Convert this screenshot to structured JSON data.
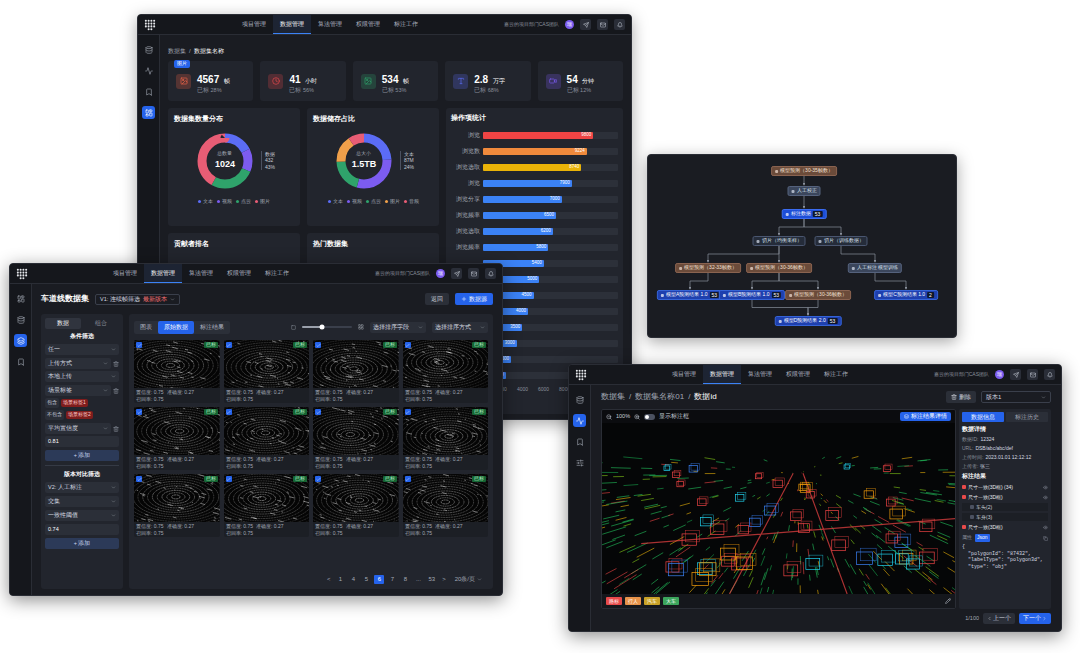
{
  "nav": {
    "items": [
      {
        "label": "项目管理",
        "selected": false
      },
      {
        "label": "数据管理",
        "selected": true
      },
      {
        "label": "算法管理",
        "selected": false
      },
      {
        "label": "权限管理",
        "selected": false
      },
      {
        "label": "标注工作",
        "selected": false
      }
    ],
    "org": "嘉云的项目部门CAS团队",
    "avatar": "瑞"
  },
  "dashboard": {
    "sidebar": [
      {
        "selected": false
      },
      {
        "selected": false
      },
      {
        "selected": false
      },
      {
        "selected": true
      }
    ],
    "breadcrumb": [
      "数据集",
      "数据集名称"
    ],
    "separator": "/",
    "stats": [
      {
        "value": "4567",
        "unit": "帧",
        "sub": "已标 28%",
        "color": "#f06548",
        "badge": "图片"
      },
      {
        "value": "41",
        "unit": "小时",
        "sub": "已标 56%",
        "color": "#e5484d"
      },
      {
        "value": "534",
        "unit": "帧",
        "sub": "已标 53%",
        "color": "#2fa36b"
      },
      {
        "value": "2.8",
        "unit": "万字",
        "sub": "已标 68%",
        "color": "#5b6cf5"
      },
      {
        "value": "54",
        "unit": "分钟",
        "sub": "已标 12%",
        "color": "#7c5cf0"
      }
    ],
    "donuts": [
      {
        "title": "数据集数量分布",
        "center_label": "总数量",
        "center_value": "1024",
        "callout": [
          "数据",
          "432",
          "43%"
        ],
        "segments": [
          {
            "label": "文本",
            "value": 180,
            "color": "#5b6cf5"
          },
          {
            "label": "视频",
            "value": 140,
            "color": "#7c5cf0"
          },
          {
            "label": "点云",
            "value": 272,
            "color": "#2fa36b"
          },
          {
            "label": "图片",
            "value": 432,
            "color": "#e85d75"
          }
        ]
      },
      {
        "title": "数据储存占比",
        "center_label": "总大小",
        "center_value": "1.5TB",
        "callout": [
          "文本",
          "87M",
          "24%"
        ],
        "segments": [
          {
            "label": "文本",
            "value": 24,
            "color": "#5b6cf5"
          },
          {
            "label": "视频",
            "value": 30,
            "color": "#7c5cf0"
          },
          {
            "label": "点云",
            "value": 20,
            "color": "#2fa36b"
          },
          {
            "label": "图片",
            "value": 16,
            "color": "#f0a04a"
          },
          {
            "label": "音频",
            "value": 10,
            "color": "#e85d75"
          }
        ]
      }
    ],
    "ops": {
      "title": "操作项统计",
      "max": 12000,
      "ticks": [
        "0",
        "2000",
        "4000",
        "6000",
        "8000",
        "10000",
        "12000"
      ],
      "bars": [
        {
          "label": "浏览",
          "value": 9800,
          "reading": "9800",
          "color": "#ef4444"
        },
        {
          "label": "浏览数",
          "value": 9224,
          "reading": "9224",
          "color": "#f08a3c"
        },
        {
          "label": "浏览选取",
          "value": 8740,
          "reading": "8740",
          "color": "#eab308"
        },
        {
          "label": "浏览",
          "value": 7900,
          "reading": "7900",
          "color": "#3b82f6"
        },
        {
          "label": "浏览分享",
          "value": 7000,
          "reading": "7000",
          "color": "#3b82f6"
        },
        {
          "label": "浏览频率",
          "value": 6500,
          "reading": "6500",
          "color": "#3b82f6"
        },
        {
          "label": "浏览选取",
          "value": 6200,
          "reading": "6200",
          "color": "#3b82f6"
        },
        {
          "label": "浏览频率",
          "value": 5800,
          "reading": "5800",
          "color": "#3b82f6"
        },
        {
          "value": 5400,
          "reading": "5400",
          "color": "#3b82f6"
        },
        {
          "value": 5000,
          "reading": "5000",
          "color": "#3b82f6"
        },
        {
          "value": 4500,
          "reading": "4500",
          "color": "#3b82f6"
        },
        {
          "value": 4000,
          "reading": "4000",
          "color": "#3b82f6"
        },
        {
          "value": 3500,
          "reading": "3500",
          "color": "#3b82f6"
        },
        {
          "value": 3000,
          "reading": "3000",
          "color": "#3b82f6"
        },
        {
          "value": 2500,
          "reading": "2500",
          "color": "#3b82f6"
        },
        {
          "value": 2000,
          "reading": "2000",
          "color": "#3b82f6"
        }
      ]
    },
    "lower_panels": [
      "贡献者排名",
      "热门数据集"
    ]
  },
  "lane": {
    "sidebar": [
      {
        "selected": false
      },
      {
        "selected": false
      },
      {
        "selected": true
      },
      {
        "selected": false
      }
    ],
    "title": "车道线数据集",
    "version": "V1: 连续帧筛选",
    "version_tag": "最新版本",
    "buttons": [
      {
        "label": "返回",
        "primary": false
      },
      {
        "label": "数据源",
        "primary": true
      }
    ],
    "side_tabs": [
      {
        "label": "数据",
        "selected": true
      },
      {
        "label": "组合",
        "selected": false
      }
    ],
    "filter_title": "条件筛选",
    "match": "任一",
    "filters": [
      {
        "kind": "select",
        "label": "上传方式",
        "value": "本地上传"
      },
      {
        "kind": "tags",
        "label": "场景标签",
        "rows": [
          {
            "op": "包含",
            "tag": "场景标签1"
          },
          {
            "op": "不包含",
            "tag": "场景标签2"
          }
        ]
      },
      {
        "kind": "input",
        "label": "平均置信度",
        "value": "0.81"
      }
    ],
    "add": "+ 添加",
    "compare_title": "版本对比筛选",
    "compare_version": "V2: 人工标注",
    "compare_mode": "交集",
    "threshold": {
      "label": "一致性阈值",
      "value": "0.74"
    },
    "view_tabs": [
      {
        "label": "图表",
        "selected": false
      },
      {
        "label": "原始数据",
        "selected": true
      },
      {
        "label": "标注结果",
        "selected": false
      }
    ],
    "zoom_level": 0.4,
    "sort": [
      "选择排序字段",
      "选择排序方式"
    ],
    "thumbs": [
      {
        "checked": true,
        "tag": "已标",
        "metrics": [
          "置信度: 0.75",
          "准确度: 0.27",
          "召回率: 0.75"
        ]
      },
      {
        "checked": true,
        "tag": "已标",
        "metrics": [
          "置信度: 0.75",
          "准确度: 0.27",
          "召回率: 0.75"
        ]
      },
      {
        "checked": true,
        "tag": "已标",
        "metrics": [
          "置信度: 0.75",
          "准确度: 0.27",
          "召回率: 0.75"
        ]
      },
      {
        "checked": true,
        "tag": "已标",
        "metrics": [
          "置信度: 0.75",
          "准确度: 0.27",
          "召回率: 0.75"
        ]
      },
      {
        "checked": true,
        "tag": "已标",
        "metrics": [
          "置信度: 0.75",
          "准确度: 0.27",
          "召回率: 0.75"
        ]
      },
      {
        "checked": true,
        "tag": "已标",
        "metrics": [
          "置信度: 0.75",
          "准确度: 0.27",
          "召回率: 0.75"
        ]
      },
      {
        "checked": true,
        "tag": "已标",
        "metrics": [
          "置信度: 0.75",
          "准确度: 0.27",
          "召回率: 0.75"
        ]
      },
      {
        "checked": true,
        "tag": "已标",
        "metrics": [
          "置信度: 0.75",
          "准确度: 0.27",
          "召回率: 0.75"
        ]
      },
      {
        "checked": true,
        "tag": "已标",
        "metrics": [
          "置信度: 0.75",
          "准确度: 0.27",
          "召回率: 0.75"
        ]
      },
      {
        "checked": true,
        "tag": "已标",
        "metrics": [
          "置信度: 0.75",
          "准确度: 0.27",
          "召回率: 0.75"
        ]
      },
      {
        "checked": true,
        "tag": "已标",
        "metrics": [
          "置信度: 0.75",
          "准确度: 0.27",
          "召回率: 0.75"
        ]
      },
      {
        "checked": true,
        "tag": "已标",
        "metrics": [
          "置信度: 0.75",
          "准确度: 0.27",
          "召回率: 0.75"
        ]
      }
    ],
    "pagination": {
      "prev": "<",
      "next": ">",
      "pages": [
        {
          "label": "1",
          "selected": false
        },
        {
          "label": "4",
          "selected": false
        },
        {
          "label": "5",
          "selected": false
        },
        {
          "label": "6",
          "selected": true
        },
        {
          "label": "7",
          "selected": false
        },
        {
          "label": "8",
          "selected": false
        },
        {
          "label": "...",
          "selected": false
        },
        {
          "label": "53",
          "selected": false
        }
      ],
      "size": "20条/页"
    }
  },
  "flow": {
    "nodes": [
      {
        "label": "模型预测（30-35帧数）",
        "kind": "predict"
      },
      {
        "label": "人工校正",
        "kind": "manual"
      },
      {
        "label": "标注数据",
        "kind": "dataset",
        "badge": "53"
      },
      {
        "label": "切片（均衡采样）",
        "kind": "split"
      },
      {
        "label": "切片（训练数据）",
        "kind": "split"
      },
      {
        "label": "模型预测（32-33帧数）",
        "kind": "predict"
      },
      {
        "label": "模型预测（30-36帧数）",
        "kind": "predict"
      },
      {
        "label": "人工标注 模型训练",
        "kind": "manual"
      },
      {
        "label": "模型A预测结果 1.0",
        "kind": "result",
        "badge": "53"
      },
      {
        "label": "模型B预测结果 1.0",
        "kind": "result",
        "badge": "53"
      },
      {
        "label": "模型预测（30-36帧数）",
        "kind": "predict"
      },
      {
        "label": "模型C预测结果 1.0",
        "kind": "result",
        "badge": "2"
      },
      {
        "label": "模型D预测结果 2.0",
        "kind": "result",
        "badge": "53"
      }
    ],
    "edges": [
      [
        0,
        1
      ],
      [
        1,
        2
      ],
      [
        2,
        3
      ],
      [
        2,
        4
      ],
      [
        3,
        5
      ],
      [
        3,
        6
      ],
      [
        4,
        7
      ],
      [
        5,
        8
      ],
      [
        6,
        9
      ],
      [
        6,
        10
      ],
      [
        7,
        11
      ],
      [
        10,
        12
      ],
      [
        9,
        12
      ]
    ]
  },
  "detail": {
    "sidebar": [
      {
        "selected": false
      },
      {
        "selected": true
      },
      {
        "selected": false
      },
      {
        "selected": false
      }
    ],
    "breadcrumb": [
      "数据集",
      "数据集名称01",
      "数据id"
    ],
    "separator": "/",
    "delete": "删除",
    "version": "版本1",
    "zoom": "100%",
    "toggle": {
      "label": "显示标注框",
      "on": false
    },
    "result_button": "标注结果详情",
    "panel_tabs": [
      {
        "label": "数据信息",
        "selected": true
      },
      {
        "label": "标注历史",
        "selected": false
      }
    ],
    "info_title": "数据详情",
    "info": [
      [
        "数据ID:",
        "12324"
      ],
      [
        "URL:",
        "DSB/abc/abc/def"
      ],
      [
        "上传时间:",
        "2023.01.01 12:12:12"
      ],
      [
        "上传者:",
        "张三"
      ]
    ],
    "result_title": "标注结果",
    "results": [
      {
        "label": "尺寸一致(3D框) (34)",
        "depth": 0,
        "color": "#e84a4a"
      },
      {
        "label": "尺寸一致(3D框)",
        "depth": 0,
        "color": "#e84a4a"
      },
      {
        "label": "车头(2)",
        "depth": 1
      },
      {
        "label": "车身(3)",
        "depth": 1
      },
      {
        "label": "尺寸一致(3D框)",
        "depth": 0,
        "color": "#e84a4a"
      }
    ],
    "attr": {
      "label": "属性",
      "modes": [
        {
          "label": "Json",
          "selected": true
        }
      ]
    },
    "json": [
      "{",
      "  \"polygonId\": \"87432\",",
      "  \"labelType\": \"polygon3d\",",
      "  \"type\": \"obj\""
    ],
    "tags": [
      {
        "label": "路标",
        "color": "#e84a4a"
      },
      {
        "label": "行人",
        "color": "#e8934a"
      },
      {
        "label": "汽车",
        "color": "#c9a227"
      },
      {
        "label": "大车",
        "color": "#3ba55c"
      }
    ],
    "pager": {
      "count": "1/100",
      "prev": "上一个",
      "next": "下一个"
    }
  }
}
